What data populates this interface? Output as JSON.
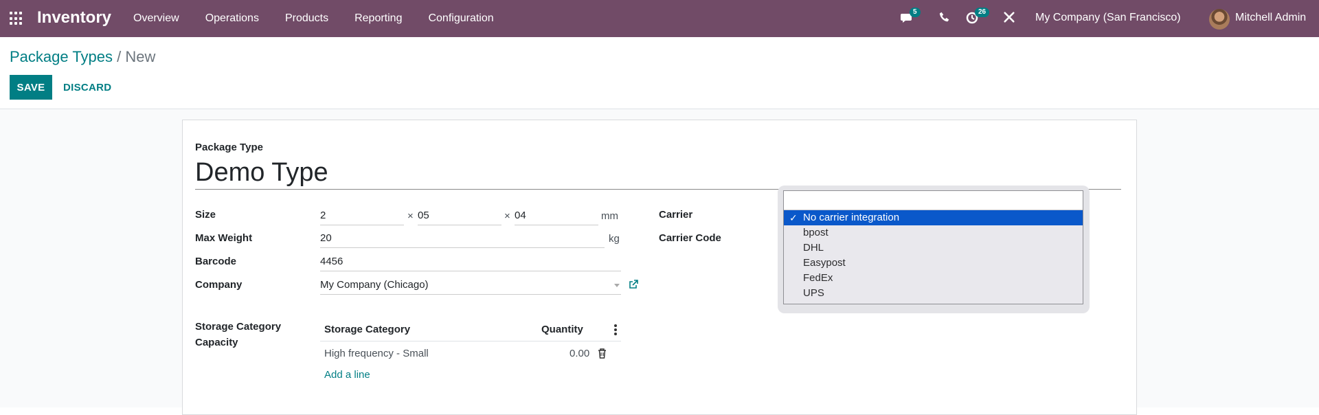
{
  "navbar": {
    "app_name": "Inventory",
    "menu": [
      "Overview",
      "Operations",
      "Products",
      "Reporting",
      "Configuration"
    ],
    "messages_badge": "5",
    "activities_badge": "26",
    "company": "My Company (San Francisco)",
    "user": "Mitchell Admin",
    "color": "#714B67"
  },
  "breadcrumb": {
    "parent": "Package Types",
    "separator": "/",
    "current": "New"
  },
  "buttons": {
    "save": "SAVE",
    "discard": "DISCARD"
  },
  "form": {
    "name_label": "Package Type",
    "name": "Demo Type",
    "size_label": "Size",
    "size": {
      "length": "2",
      "width": "05",
      "height": "04",
      "times": "×",
      "unit": "mm"
    },
    "max_weight_label": "Max Weight",
    "max_weight": "20",
    "weight_unit": "kg",
    "barcode_label": "Barcode",
    "barcode": "4456",
    "company_label": "Company",
    "company": "My Company (Chicago)",
    "carrier_label": "Carrier",
    "carrier_code_label": "Carrier Code",
    "storage_label": "Storage Category Capacity",
    "storage_table": {
      "headers": {
        "category": "Storage Category",
        "quantity": "Quantity"
      },
      "rows": [
        {
          "category": "High frequency - Small",
          "quantity": "0.00"
        }
      ],
      "add_line": "Add a line"
    }
  },
  "carrier_dropdown": {
    "selected": "No carrier integration",
    "check": "✓",
    "options": [
      "No carrier integration",
      "bpost",
      "DHL",
      "Easypost",
      "FedEx",
      "UPS"
    ]
  },
  "accent_color": "#017E84"
}
